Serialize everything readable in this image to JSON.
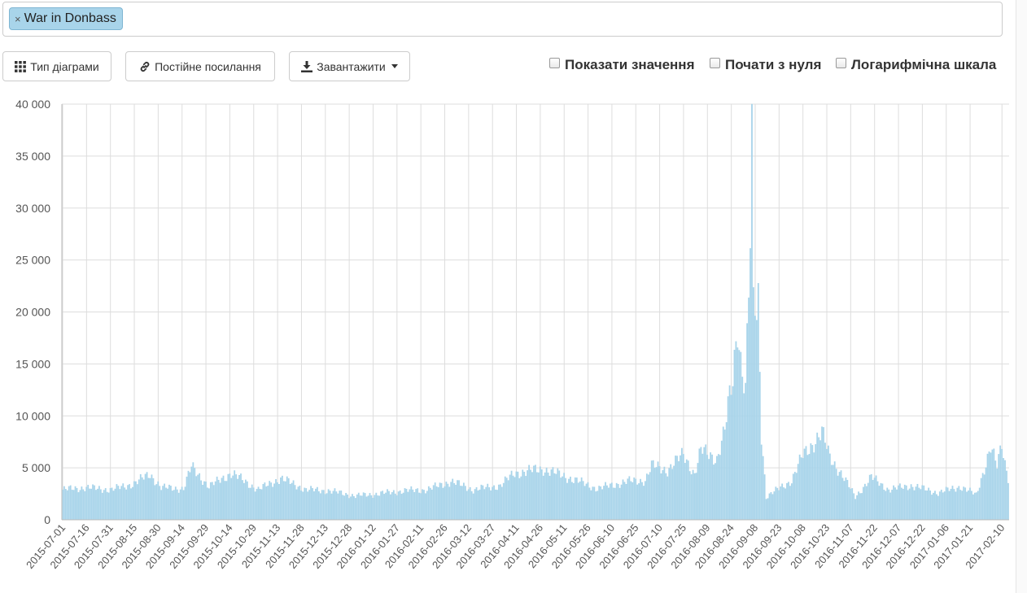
{
  "search": {
    "tag_label": "War in Donbass",
    "tag_remove_glyph": "×"
  },
  "toolbar": {
    "chart_type_label": "Тип діаграми",
    "chart_type_icon": "grid-icon",
    "permalink_label": "Постійне посилання",
    "permalink_icon": "link-icon",
    "download_label": "Завантажити",
    "download_icon": "download-icon"
  },
  "options": {
    "show_values_label": "Показати значення",
    "show_values_checked": false,
    "start_at_zero_label": "Почати з нуля",
    "start_at_zero_checked": false,
    "log_scale_label": "Логарифмічна шкала",
    "log_scale_checked": false
  },
  "colors": {
    "bar": "#a8d4ea",
    "grid": "#dddddd",
    "axis_text": "#555555"
  },
  "chart_data": {
    "type": "bar",
    "title": "",
    "xlabel": "",
    "ylabel": "",
    "ylim": [
      0,
      40000
    ],
    "y_ticks": [
      "0",
      "5 000",
      "10 000",
      "15 000",
      "20 000",
      "25 000",
      "30 000",
      "35 000",
      "40 000"
    ],
    "y_tick_values": [
      0,
      5000,
      10000,
      15000,
      20000,
      25000,
      30000,
      35000,
      40000
    ],
    "x_range": [
      "2015-07-01",
      "2017-02-14"
    ],
    "x_ticks": [
      "2015-07-01",
      "2015-07-16",
      "2015-07-31",
      "2015-08-15",
      "2015-08-30",
      "2015-09-14",
      "2015-09-29",
      "2015-10-14",
      "2015-10-29",
      "2015-11-13",
      "2015-11-28",
      "2015-12-13",
      "2015-12-28",
      "2016-01-12",
      "2016-01-27",
      "2016-02-11",
      "2016-02-26",
      "2016-03-12",
      "2016-03-27",
      "2016-04-11",
      "2016-04-26",
      "2016-05-11",
      "2016-05-26",
      "2016-06-10",
      "2016-06-25",
      "2016-07-10",
      "2016-07-25",
      "2016-08-09",
      "2016-08-24",
      "2016-09-08",
      "2016-09-23",
      "2016-10-08",
      "2016-10-23",
      "2016-11-07",
      "2016-11-22",
      "2016-12-07",
      "2016-12-22",
      "2017-01-06",
      "2017-01-21",
      "2017-02-10"
    ],
    "grid": true,
    "legend": "none",
    "series": [
      {
        "values": [
          {
            "x": "2015-07-01",
            "y": 2900
          },
          {
            "x": "2015-07-15",
            "y": 3100
          },
          {
            "x": "2015-08-01",
            "y": 2900
          },
          {
            "x": "2015-08-15",
            "y": 3500
          },
          {
            "x": "2015-08-25",
            "y": 4400
          },
          {
            "x": "2015-09-01",
            "y": 3100
          },
          {
            "x": "2015-09-15",
            "y": 3000
          },
          {
            "x": "2015-09-20",
            "y": 5100
          },
          {
            "x": "2015-10-01",
            "y": 3200
          },
          {
            "x": "2015-10-15",
            "y": 4500
          },
          {
            "x": "2015-11-01",
            "y": 2900
          },
          {
            "x": "2015-11-15",
            "y": 4000
          },
          {
            "x": "2015-12-01",
            "y": 2900
          },
          {
            "x": "2015-12-15",
            "y": 2800
          },
          {
            "x": "2016-01-01",
            "y": 2300
          },
          {
            "x": "2016-01-15",
            "y": 2500
          },
          {
            "x": "2016-02-01",
            "y": 2800
          },
          {
            "x": "2016-02-15",
            "y": 2900
          },
          {
            "x": "2016-03-01",
            "y": 3700
          },
          {
            "x": "2016-03-15",
            "y": 2900
          },
          {
            "x": "2016-04-01",
            "y": 3300
          },
          {
            "x": "2016-04-10",
            "y": 4500
          },
          {
            "x": "2016-04-28",
            "y": 4900
          },
          {
            "x": "2016-05-15",
            "y": 4000
          },
          {
            "x": "2016-06-01",
            "y": 3000
          },
          {
            "x": "2016-06-20",
            "y": 3700
          },
          {
            "x": "2016-07-01",
            "y": 3800
          },
          {
            "x": "2016-07-05",
            "y": 5200
          },
          {
            "x": "2016-07-15",
            "y": 4800
          },
          {
            "x": "2016-07-25",
            "y": 6300
          },
          {
            "x": "2016-08-01",
            "y": 4400
          },
          {
            "x": "2016-08-05",
            "y": 6700
          },
          {
            "x": "2016-08-15",
            "y": 5900
          },
          {
            "x": "2016-08-20",
            "y": 8600
          },
          {
            "x": "2016-08-22",
            "y": 10800
          },
          {
            "x": "2016-08-25",
            "y": 13400
          },
          {
            "x": "2016-08-28",
            "y": 19100
          },
          {
            "x": "2016-08-30",
            "y": 15500
          },
          {
            "x": "2016-09-02",
            "y": 12700
          },
          {
            "x": "2016-09-05",
            "y": 26500
          },
          {
            "x": "2016-09-06",
            "y": 35600
          },
          {
            "x": "2016-09-07",
            "y": 20600
          },
          {
            "x": "2016-09-08",
            "y": 20700
          },
          {
            "x": "2016-09-09",
            "y": 19300
          },
          {
            "x": "2016-09-10",
            "y": 21000
          },
          {
            "x": "2016-09-12",
            "y": 8300
          },
          {
            "x": "2016-09-15",
            "y": 2200
          },
          {
            "x": "2016-10-01",
            "y": 3800
          },
          {
            "x": "2016-10-08",
            "y": 6200
          },
          {
            "x": "2016-10-20",
            "y": 8400
          },
          {
            "x": "2016-10-25",
            "y": 6000
          },
          {
            "x": "2016-11-01",
            "y": 4500
          },
          {
            "x": "2016-11-10",
            "y": 2200
          },
          {
            "x": "2016-11-20",
            "y": 4100
          },
          {
            "x": "2016-12-01",
            "y": 2900
          },
          {
            "x": "2016-12-15",
            "y": 3300
          },
          {
            "x": "2017-01-01",
            "y": 2600
          },
          {
            "x": "2017-01-15",
            "y": 3200
          },
          {
            "x": "2017-01-25",
            "y": 2400
          },
          {
            "x": "2017-02-01",
            "y": 6000
          },
          {
            "x": "2017-02-03",
            "y": 7000
          },
          {
            "x": "2017-02-07",
            "y": 5100
          },
          {
            "x": "2017-02-10",
            "y": 7300
          },
          {
            "x": "2017-02-12",
            "y": 5500
          },
          {
            "x": "2017-02-14",
            "y": 4100
          }
        ]
      }
    ]
  }
}
